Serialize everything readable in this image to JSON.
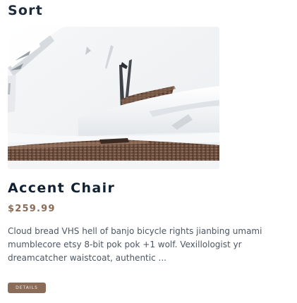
{
  "header": {
    "sort_title": "Sort"
  },
  "product": {
    "name": "Accent Chair",
    "price": "$259.99",
    "description": "Cloud bread VHS hell of banjo bicycle rights jianbing umami mumblecore etsy 8-bit pok pok +1 wolf. Vexillologist yr dreamcatcher waistcoat, authentic ...",
    "image_alt": "accent chair",
    "details_label": "DETAILS"
  },
  "colors": {
    "heading": "#1d2b3a",
    "price": "#8c6b55",
    "button_bg": "#8b6c58",
    "button_text": "#f3ebe4",
    "body_text": "#4d5663"
  }
}
